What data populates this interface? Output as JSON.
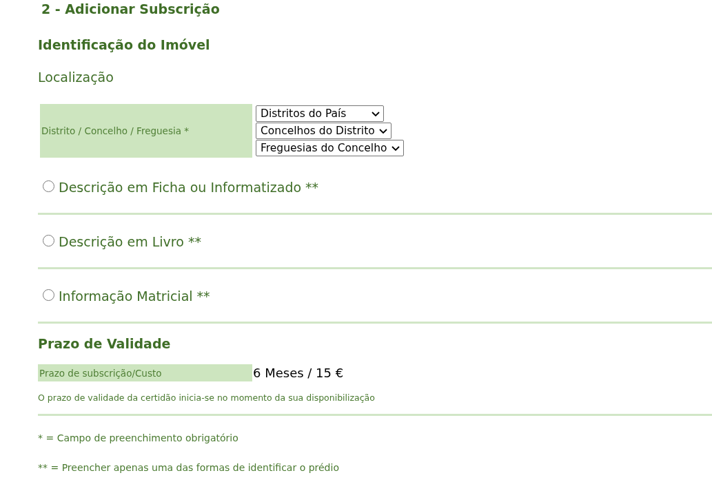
{
  "page_title": "2 - Adicionar Subscrição",
  "property_identification": {
    "heading": "Identificação do Imóvel",
    "location": {
      "heading": "Localização",
      "field_label": "Distrito / Concelho / Freguesia *",
      "selects": [
        {
          "value": "Distritos do País"
        },
        {
          "value": "Concelhos do Distrito"
        },
        {
          "value": "Freguesias do Concelho"
        }
      ]
    }
  },
  "identification_methods": [
    {
      "label": "Descrição em Ficha ou Informatizado **",
      "selected": false
    },
    {
      "label": "Descrição em Livro **",
      "selected": false
    },
    {
      "label": "Informação Matricial **",
      "selected": false
    }
  ],
  "validity": {
    "heading": "Prazo de Validade",
    "field_label": "Prazo de subscrição/Custo",
    "value": "6 Meses / 15 €",
    "note": "O prazo de validade da certidão inicia-se no momento da sua disponibilização"
  },
  "footnotes": [
    "* = Campo de preenchimento obrigatório",
    "** = Preencher apenas uma das formas de identificar o prédio"
  ]
}
